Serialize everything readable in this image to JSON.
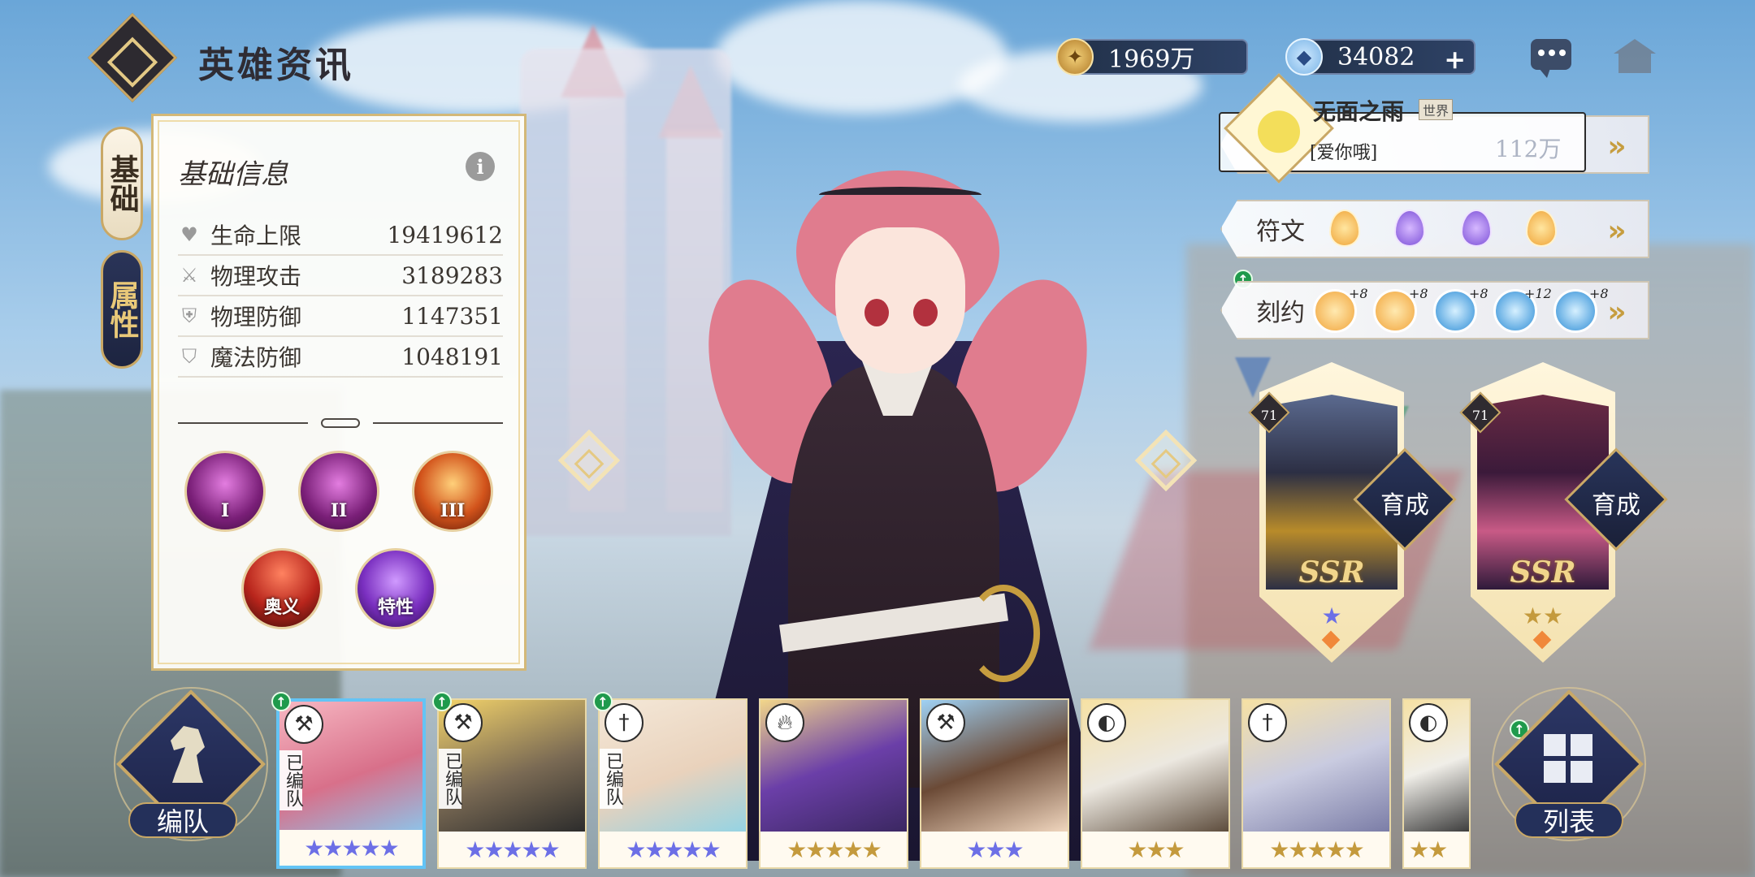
{
  "header": {
    "title": "英雄资讯",
    "gold": "1969万",
    "gems": "34082",
    "plus": "+"
  },
  "side_tabs": [
    {
      "label": "基础"
    },
    {
      "label": "属性"
    }
  ],
  "info_panel": {
    "title": "基础信息",
    "info_icon": "i",
    "stats": [
      {
        "icon": "heart-icon",
        "label": "生命上限",
        "value": "19419612"
      },
      {
        "icon": "sword-icon",
        "label": "物理攻击",
        "value": "3189283"
      },
      {
        "icon": "shield-icon",
        "label": "物理防御",
        "value": "1147351"
      },
      {
        "icon": "magic-shield-icon",
        "label": "魔法防御",
        "value": "1048191"
      }
    ],
    "skills": [
      {
        "label": "I"
      },
      {
        "label": "II"
      },
      {
        "label": "III"
      },
      {
        "label": "奥义"
      },
      {
        "label": "特性"
      }
    ]
  },
  "chat": {
    "name": "无面之雨",
    "tag": "世界",
    "message": "[爱你哦]",
    "ghost": "112万"
  },
  "right_panels": {
    "runes_label": "符文",
    "pact_label": "刻约",
    "pact_levels": [
      "+8",
      "+8",
      "+8",
      "+12",
      "+8"
    ]
  },
  "partners": [
    {
      "level": "71",
      "rarity": "SSR",
      "stars": "★",
      "button": "育成"
    },
    {
      "level": "71",
      "rarity": "SSR",
      "stars": "★★",
      "button": "育成"
    }
  ],
  "bottom": {
    "team_label": "编队",
    "list_label": "列表",
    "team_tag": "已编队"
  },
  "hero_cards": [
    {
      "class_icon": "axe-icon",
      "in_team": true,
      "stars": "★★★★★",
      "star_color": "blue",
      "selected": true
    },
    {
      "class_icon": "axe-icon",
      "in_team": true,
      "stars": "★★★★★",
      "star_color": "blue",
      "selected": false
    },
    {
      "class_icon": "sword-icon",
      "in_team": true,
      "stars": "★★★★★",
      "star_color": "blue",
      "selected": false
    },
    {
      "class_icon": "fire-icon",
      "in_team": false,
      "stars": "★★★★★",
      "star_color": "gold",
      "selected": false
    },
    {
      "class_icon": "axe-icon",
      "in_team": false,
      "stars": "★★★",
      "star_color": "blue",
      "selected": false
    },
    {
      "class_icon": "mask-icon",
      "in_team": false,
      "stars": "★★★",
      "star_color": "gold",
      "selected": false
    },
    {
      "class_icon": "sword-icon",
      "in_team": false,
      "stars": "★★★★★",
      "star_color": "gold",
      "selected": false
    },
    {
      "class_icon": "mask-icon",
      "in_team": false,
      "stars": "★★",
      "star_color": "gold",
      "selected": false
    }
  ]
}
